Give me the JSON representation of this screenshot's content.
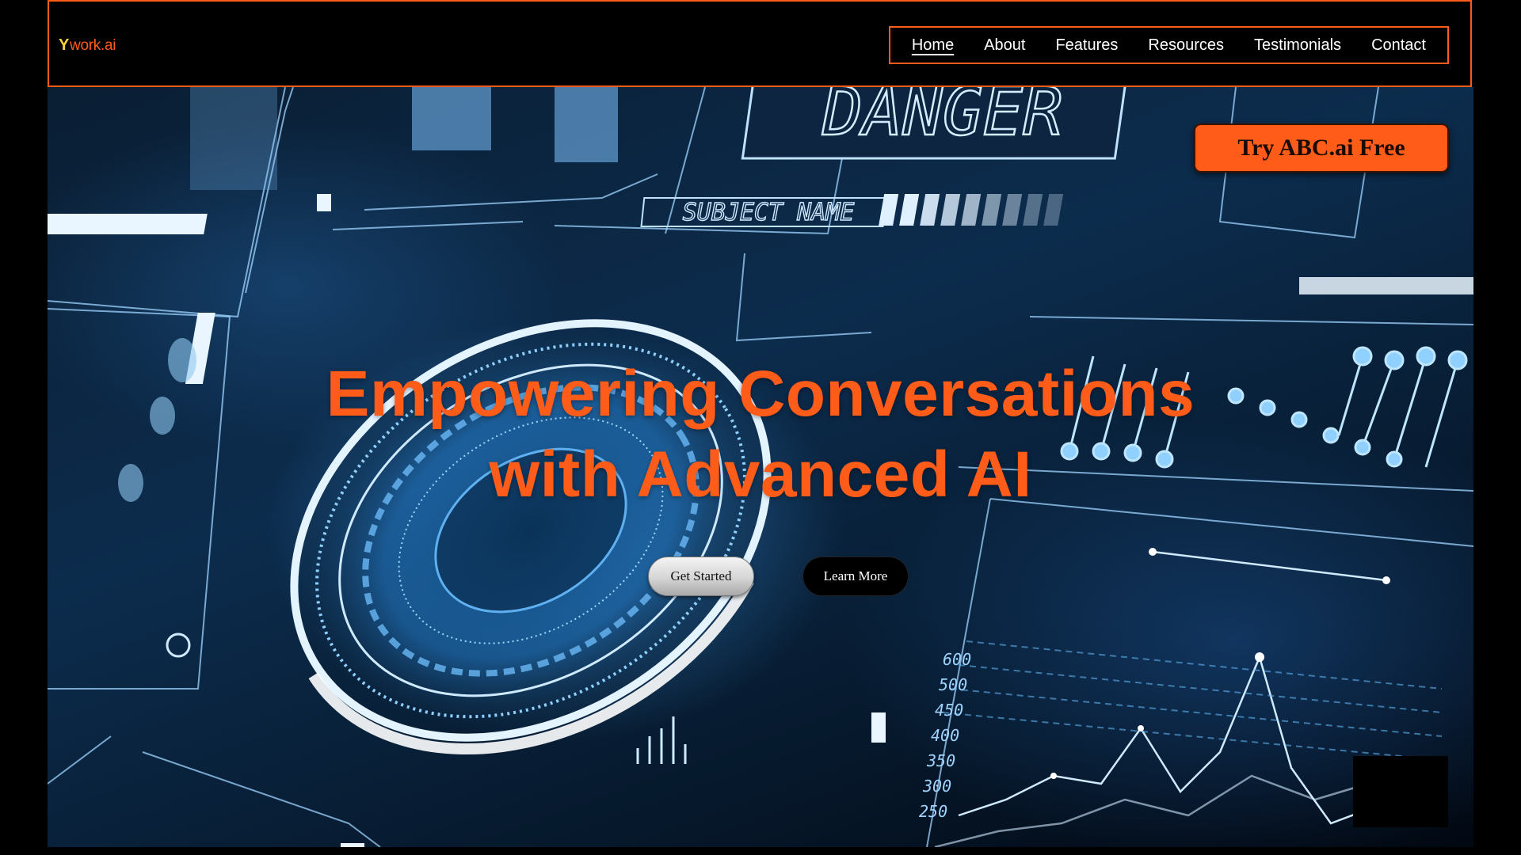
{
  "brand": {
    "logo_mark": "Y",
    "logo_text": "work.ai",
    "accent": "#ff5c1a"
  },
  "nav": {
    "items": [
      {
        "label": "Home",
        "active": true
      },
      {
        "label": "About",
        "active": false
      },
      {
        "label": "Features",
        "active": false
      },
      {
        "label": "Resources",
        "active": false
      },
      {
        "label": "Testimonials",
        "active": false
      },
      {
        "label": "Contact",
        "active": false
      }
    ]
  },
  "hero": {
    "background": "futuristic-hud-hologram-image",
    "hud_text": {
      "danger": "DANGER",
      "subject": "SUBJECT NAME",
      "scale": [
        "600",
        "500",
        "450",
        "400",
        "350",
        "300",
        "250"
      ]
    },
    "title_line1": "Empowering Conversations",
    "title_line2": "with Advanced AI",
    "cta_label": "Try ABC.ai Free",
    "get_started_label": "Get Started",
    "learn_more_label": "Learn More"
  }
}
